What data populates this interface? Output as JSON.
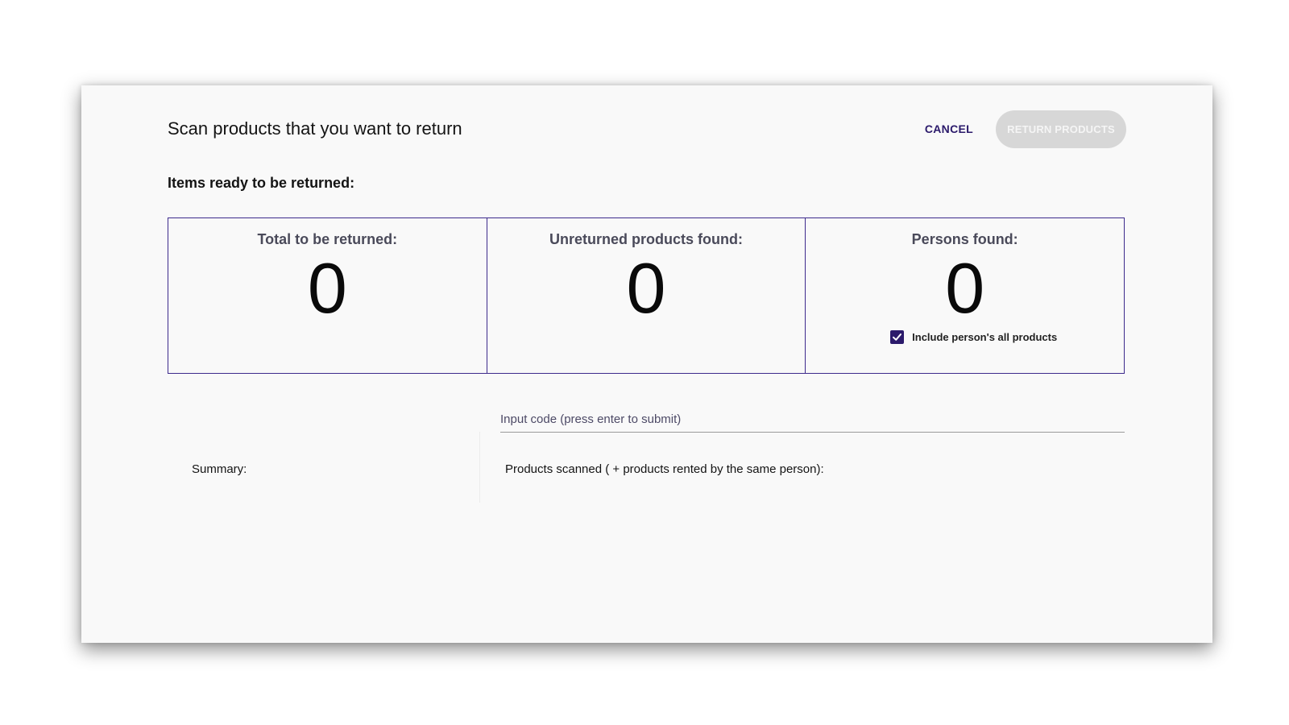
{
  "dialog": {
    "title": "Scan products that you want to return",
    "cancel_label": "CANCEL",
    "return_label": "RETURN PRODUCTS",
    "subheading": "Items ready to be returned:"
  },
  "stats": [
    {
      "label": "Total to be returned:",
      "value": "0"
    },
    {
      "label": "Unreturned products found:",
      "value": "0"
    },
    {
      "label": "Persons found:",
      "value": "0"
    }
  ],
  "include_all": {
    "label": "Include person's all products",
    "checked": true
  },
  "code_input": {
    "placeholder": "Input code (press enter to submit)",
    "value": ""
  },
  "summary": {
    "label": "Summary:"
  },
  "scanned": {
    "label": "Products scanned ( + products rented by the same person):"
  },
  "colors": {
    "accent": "#2b1a6b",
    "border": "#3d2a8c",
    "disabled_button": "#d7d7d7"
  },
  "icons": {
    "checkbox": "check-icon"
  }
}
